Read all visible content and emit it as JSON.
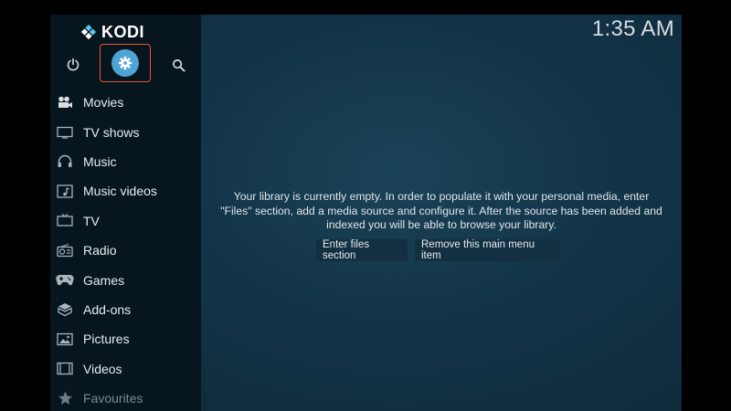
{
  "app": {
    "name": "KODI"
  },
  "header": {
    "clock": "1:35 AM",
    "power": {
      "icon": "power-icon"
    },
    "settings": {
      "icon": "gear-icon",
      "highlight_color": "#e8552e",
      "circle_color": "#4ea4d4"
    },
    "search": {
      "icon": "search-icon"
    }
  },
  "sidebar": {
    "items": [
      {
        "label": "Movies",
        "icon": "movies-icon"
      },
      {
        "label": "TV shows",
        "icon": "tv-shows-icon"
      },
      {
        "label": "Music",
        "icon": "headphones-icon"
      },
      {
        "label": "Music videos",
        "icon": "music-videos-icon"
      },
      {
        "label": "TV",
        "icon": "tv-icon"
      },
      {
        "label": "Radio",
        "icon": "radio-icon"
      },
      {
        "label": "Games",
        "icon": "gamepad-icon"
      },
      {
        "label": "Add-ons",
        "icon": "addons-icon"
      },
      {
        "label": "Pictures",
        "icon": "pictures-icon"
      },
      {
        "label": "Videos",
        "icon": "videos-icon"
      },
      {
        "label": "Favourites",
        "icon": "star-icon"
      }
    ]
  },
  "main": {
    "message_line1": "Your library is currently empty. In order to populate it with your personal media, enter",
    "message_line2": "\"Files\" section, add a media source and configure it. After the source has been added and",
    "message_line3": "indexed you will be able to browse your library.",
    "enter_files_label": "Enter files section",
    "remove_item_label": "Remove this main menu item"
  },
  "colors": {
    "background": "#133448",
    "sidebar": "#07151f",
    "accent": "#4ea4d4"
  }
}
